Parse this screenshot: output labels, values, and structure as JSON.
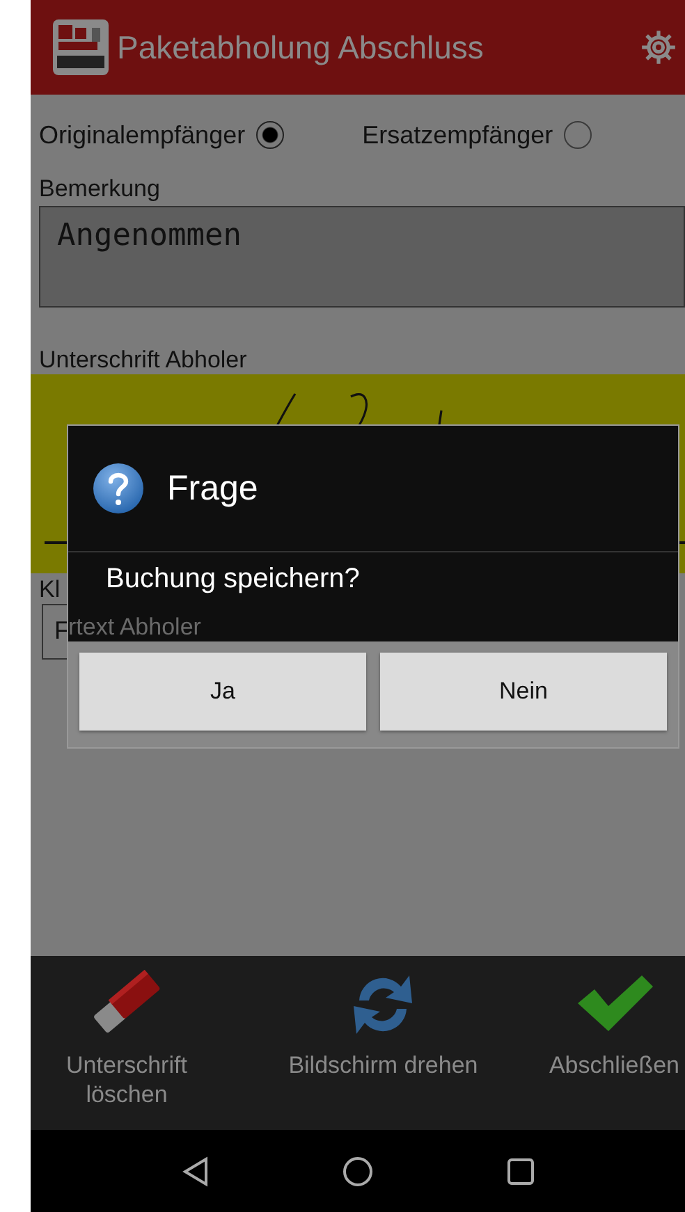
{
  "header": {
    "title": "Paketabholung Abschluss"
  },
  "recipient_options": [
    {
      "label": "Originalempfänger",
      "selected": true
    },
    {
      "label": "Ersatzempfänger",
      "selected": false
    }
  ],
  "remark": {
    "label": "Bemerkung",
    "value": "Angenommen"
  },
  "signature": {
    "label": "Unterschrift Abholer"
  },
  "name_field": {
    "label": "Kl",
    "value": "F"
  },
  "dialog": {
    "title": "Frage",
    "message": "Buchung speichern?",
    "covered_text": "rtext Abholer",
    "buttons": [
      "Ja",
      "Nein"
    ]
  },
  "toolbar": [
    {
      "kind": "eraser",
      "label": "Unterschrift löschen"
    },
    {
      "kind": "rotate",
      "label": "Bildschirm drehen"
    },
    {
      "kind": "check",
      "label": "Abschließen"
    }
  ],
  "nav_buttons": [
    {
      "kind": "back"
    },
    {
      "kind": "home"
    },
    {
      "kind": "recent"
    }
  ]
}
